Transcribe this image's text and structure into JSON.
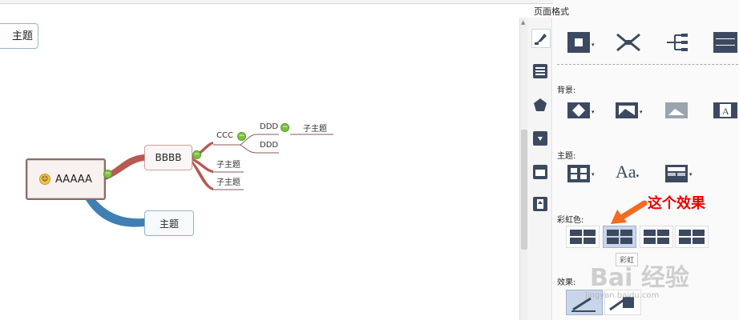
{
  "panel": {
    "title": "页面格式",
    "background_label": "背景:",
    "theme_label": "主题:",
    "rainbow_label": "彩虹色:",
    "effect_label": "效果:",
    "theme_font_glyph": "Aa",
    "rainbow_tooltip": "彩虹"
  },
  "annotation": {
    "callout": "这个效果",
    "arrow_color": "#f26b21"
  },
  "watermark": {
    "text": "Bai 经验",
    "url": "jingyan.baidu.com"
  },
  "mindmap": {
    "floating_topic": "主题",
    "central": "AAAAA",
    "branch1": "BBBB",
    "branch2": "主题",
    "ccc": "CCC",
    "ddd1": "DDD",
    "ddd2": "DDD",
    "sub_ddd": "子主题",
    "sub1": "子主题",
    "sub2": "子主题"
  },
  "colors": {
    "branch_red": "#b65a52",
    "branch_blue": "#3f7fb3",
    "icon_dark": "#3c4a61",
    "selected_bg": "#c9d6ea"
  }
}
